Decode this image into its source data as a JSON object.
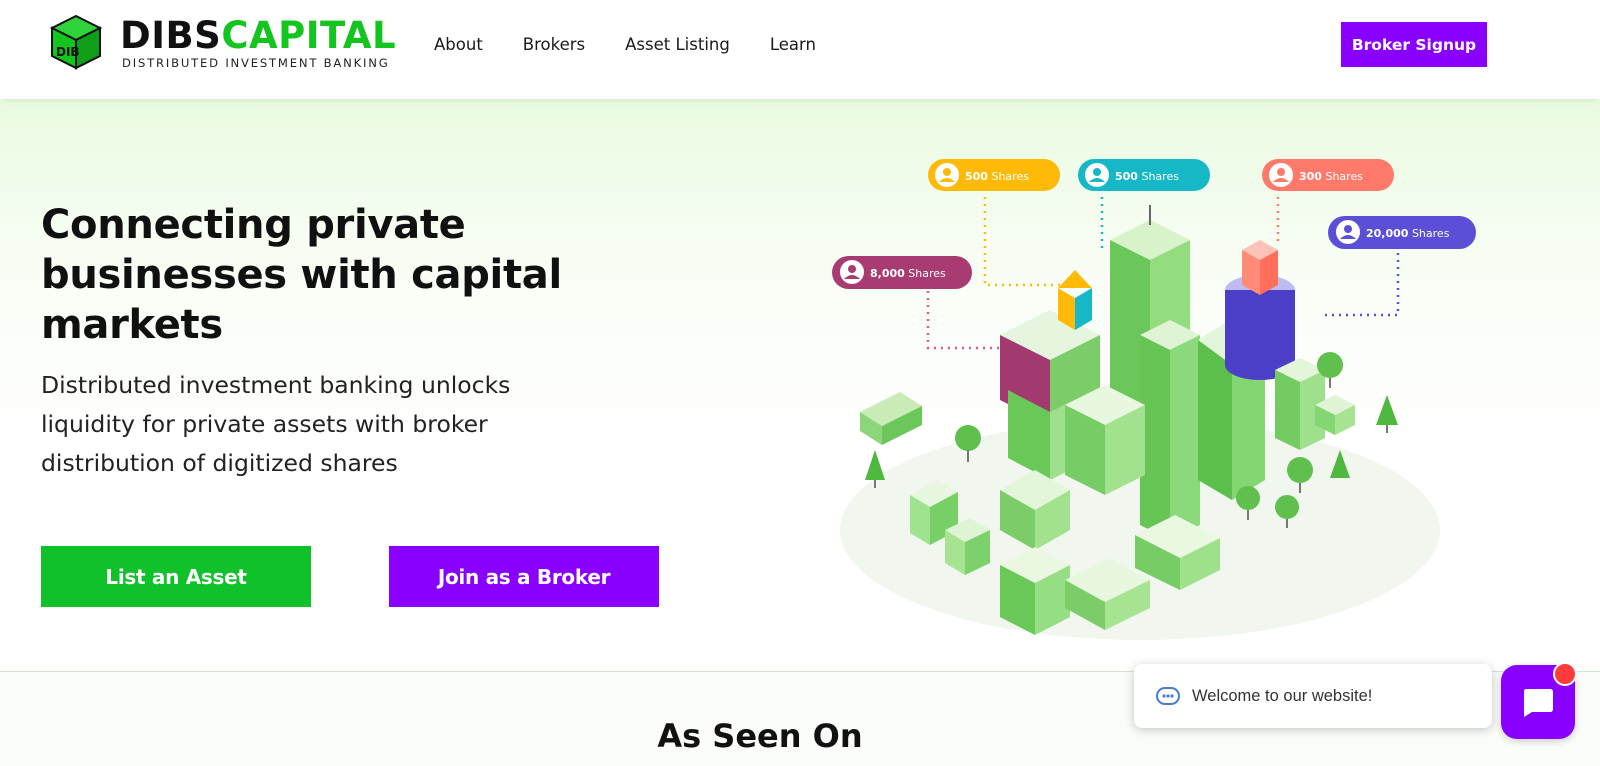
{
  "brand": {
    "logo_mark": "DIB",
    "name_dark": "DIBS",
    "name_green": "CAPITAL",
    "tagline": "DISTRIBUTED INVESTMENT BANKING",
    "colors": {
      "green": "#14c51f",
      "purple": "#8a00ff",
      "dark": "#111111"
    }
  },
  "nav": {
    "items": [
      {
        "label": "About"
      },
      {
        "label": "Brokers"
      },
      {
        "label": "Asset Listing"
      },
      {
        "label": "Learn"
      }
    ],
    "signup_label": "Broker Signup"
  },
  "hero": {
    "title": "Connecting private businesses with capital markets",
    "subtitle": "Distributed investment banking unlocks liquidity for private assets with broker distribution of digitized shares",
    "cta_primary": "List an Asset",
    "cta_secondary": "Join as a Broker"
  },
  "illustration": {
    "tags": [
      {
        "amount": "500",
        "unit": "Shares",
        "color": "#ffba08"
      },
      {
        "amount": "500",
        "unit": "Shares",
        "color": "#16b8c8"
      },
      {
        "amount": "300",
        "unit": "Shares",
        "color": "#ff7a6b"
      },
      {
        "amount": "20,000",
        "unit": "Shares",
        "color": "#5a4fd6"
      },
      {
        "amount": "8,000",
        "unit": "Shares",
        "color": "#a83c72"
      }
    ]
  },
  "seen": {
    "title": "As Seen On"
  },
  "chat": {
    "welcome": "Welcome to our website!",
    "bubble_icon": "chat-bot-icon",
    "launcher_icon": "chat-icon"
  }
}
